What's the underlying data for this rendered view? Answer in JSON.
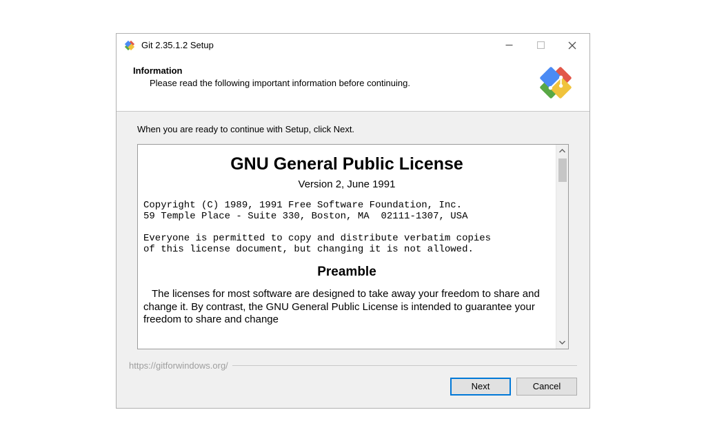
{
  "titlebar": {
    "title": "Git 2.35.1.2 Setup"
  },
  "header": {
    "title": "Information",
    "subtitle": "Please read the following important information before continuing."
  },
  "body": {
    "instruction": "When you are ready to continue with Setup, click Next."
  },
  "license": {
    "heading": "GNU General Public License",
    "version": "Version 2, June 1991",
    "copyright": "Copyright (C) 1989, 1991 Free Software Foundation, Inc.\n59 Temple Place - Suite 330, Boston, MA  02111-1307, USA\n\nEveryone is permitted to copy and distribute verbatim copies\nof this license document, but changing it is not allowed.",
    "preamble_heading": "Preamble",
    "preamble_body": "The licenses for most software are designed to take away your freedom to share and change it. By contrast, the GNU General Public License is intended to guarantee your freedom to share and change"
  },
  "footer": {
    "url": "https://gitforwindows.org/",
    "next_label": "Next",
    "cancel_label": "Cancel"
  }
}
